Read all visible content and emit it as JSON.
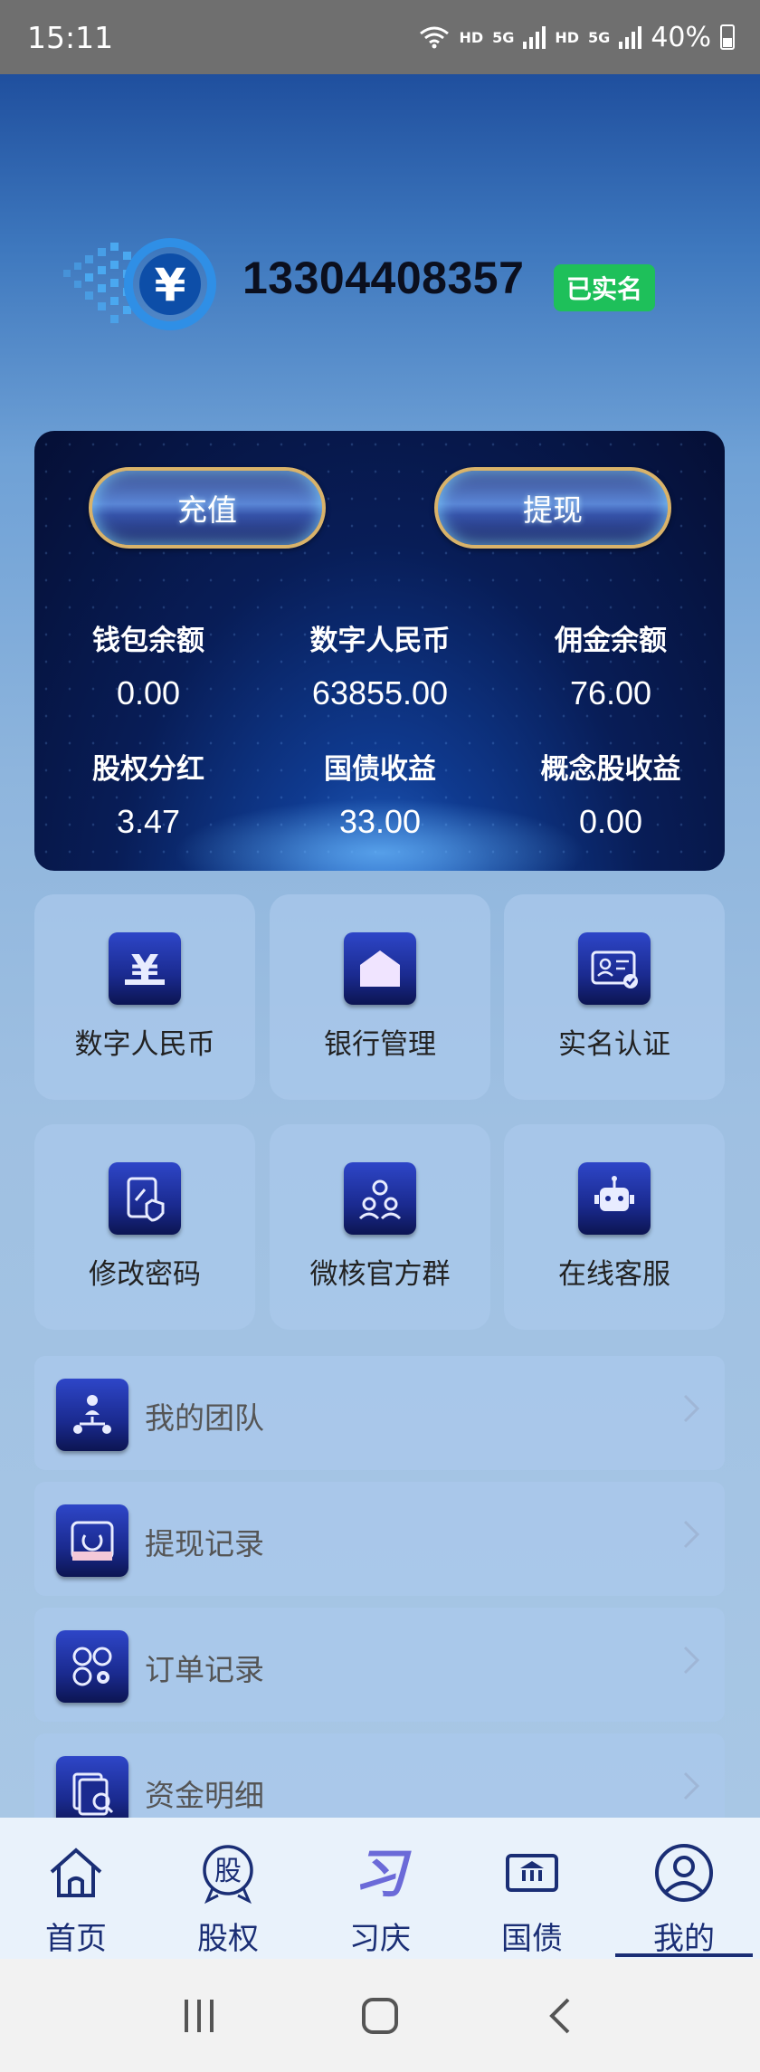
{
  "status_bar": {
    "time": "15:11",
    "battery": "40%",
    "hd1": "HD",
    "hd2": "HD",
    "net1": "5G",
    "net2": "5G"
  },
  "profile": {
    "phone": "13304408357",
    "badge": "已实名"
  },
  "wallet": {
    "recharge_label": "充值",
    "withdraw_label": "提现",
    "stats": [
      {
        "label": "钱包余额",
        "value": "0.00"
      },
      {
        "label": "数字人民币",
        "value": "63855.00"
      },
      {
        "label": "佣金余额",
        "value": "76.00"
      },
      {
        "label": "股权分红",
        "value": "3.47"
      },
      {
        "label": "国债收益",
        "value": "33.00"
      },
      {
        "label": "概念股收益",
        "value": "0.00"
      }
    ]
  },
  "grid": [
    {
      "label": "数字人民币",
      "icon": "yuan-icon"
    },
    {
      "label": "银行管理",
      "icon": "bank-icon"
    },
    {
      "label": "实名认证",
      "icon": "id-card-icon"
    },
    {
      "label": "修改密码",
      "icon": "password-icon"
    },
    {
      "label": "微核官方群",
      "icon": "group-icon"
    },
    {
      "label": "在线客服",
      "icon": "robot-icon"
    }
  ],
  "list": [
    {
      "label": "我的团队",
      "icon": "team-icon"
    },
    {
      "label": "提现记录",
      "icon": "withdraw-record-icon"
    },
    {
      "label": "订单记录",
      "icon": "order-record-icon"
    },
    {
      "label": "资金明细",
      "icon": "funds-detail-icon"
    }
  ],
  "nav": [
    {
      "label": "首页",
      "icon": "home-icon"
    },
    {
      "label": "股权",
      "icon": "equity-icon",
      "glyph": "股"
    },
    {
      "label": "习庆",
      "icon": "xiqing-icon",
      "glyph": "习"
    },
    {
      "label": "国债",
      "icon": "bond-icon"
    },
    {
      "label": "我的",
      "icon": "profile-icon"
    }
  ],
  "colors": {
    "accent": "#1a2e75",
    "badge": "#1ec05a",
    "icon_bg": "#1a2a8f"
  }
}
